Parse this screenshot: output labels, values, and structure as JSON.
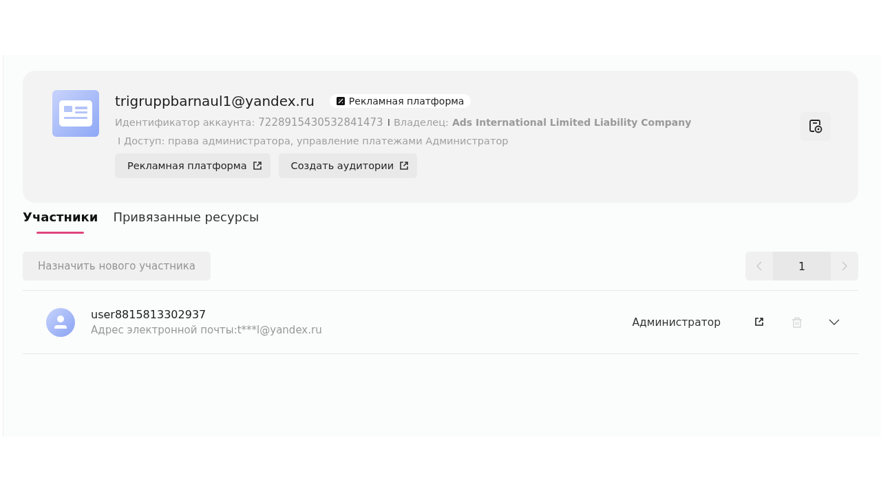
{
  "account": {
    "email": "trigruppbarnaul1@yandex.ru",
    "badge": "Рекламная платформа",
    "fields": [
      {
        "label": "Идентификатор аккаунта:",
        "value": "7228915430532841473"
      },
      {
        "separator": "I",
        "label": "Владелец:",
        "value": "Ads International Limited Liability Company"
      }
    ],
    "access": "I Доступ: права администратора, управление платежами Администратор",
    "links": [
      "Рекламная платформа",
      "Создать аудитории"
    ]
  },
  "tabs": [
    {
      "label": "Участники",
      "selected": true
    },
    {
      "label": "Привязанные ресурсы",
      "selected": false
    }
  ],
  "assign_button": {
    "label": "Назначить нового участника",
    "disabled": true
  },
  "pagination": {
    "page": "1",
    "prev_disabled": true,
    "next_disabled": true
  },
  "members": [
    {
      "name": "user8815813302937",
      "email": "Адрес электронной почты:t***l@yandex.ru",
      "role": "Администратор",
      "delete_disabled": true
    }
  ]
}
